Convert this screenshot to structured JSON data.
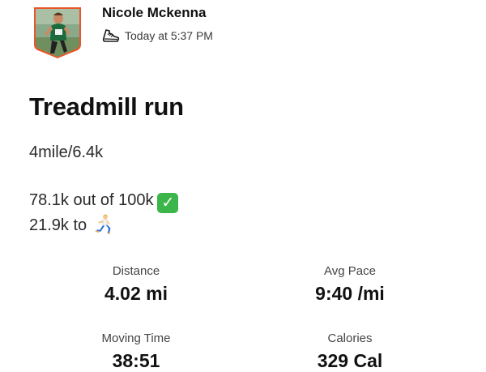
{
  "athlete": {
    "name": "Nicole Mckenna",
    "timestamp": "Today at 5:37 PM",
    "activity_icon": "shoe-icon",
    "avatar_border_color": "#e8552a"
  },
  "activity": {
    "title": "Treadmill run",
    "description": {
      "line1": "4mile/6.4k",
      "line2": "78.1k out of 100k",
      "line2_emoji": "check-mark-button",
      "line3": "21.9k to",
      "line3_emoji": "runner"
    }
  },
  "stats": [
    {
      "label": "Distance",
      "value": "4.02 mi"
    },
    {
      "label": "Avg Pace",
      "value": "9:40 /mi"
    },
    {
      "label": "Moving Time",
      "value": "38:51"
    },
    {
      "label": "Calories",
      "value": "329 Cal"
    }
  ]
}
